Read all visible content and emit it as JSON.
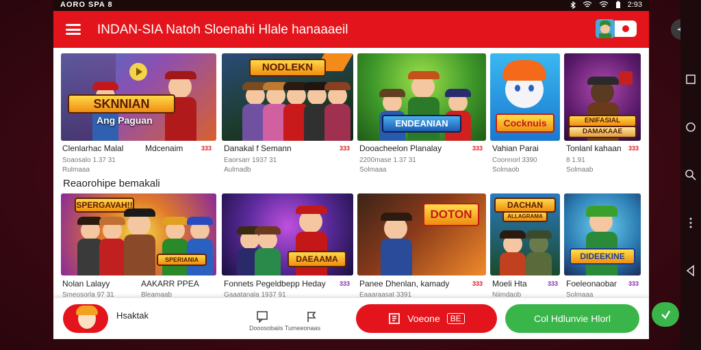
{
  "status_bar": {
    "left": "AORO SPA 8",
    "time": "2:93"
  },
  "header": {
    "title": "INDAN-SIA Natoh Sloenahi Hlale hanaaaeil"
  },
  "featured": [
    {
      "art": "SKNNIAN",
      "art2": "Ang Paguan",
      "title": "Clenlarhac Malal",
      "sub1": "Soaosalo 1.37 31",
      "sub2": "Rulmaaa",
      "extra": "Mdcenaim",
      "rating": "333"
    },
    {
      "art": "NODLEKN",
      "title": "Danakal f Semann",
      "sub1": "Eaorsarr 1937 31",
      "sub2": "Aulmadb",
      "rating": "333"
    },
    {
      "art": "ENDEANIAN",
      "title": "Dooacheelon Planalay",
      "sub1": "2200mase 1.37 31",
      "sub2": "Solmaaa",
      "rating": "333"
    },
    {
      "art": "Cocknuis",
      "title": "Vahian Parai",
      "sub1": "Coonnorl 3390",
      "sub2": "Solmaob",
      "rating": ""
    },
    {
      "art": "ENIFASIAL",
      "art2": "DAMAKAAE",
      "title": "Tonlanl kahaan",
      "sub1": "8 1.91",
      "sub2": "Solmaab",
      "rating": "333"
    }
  ],
  "section_title": "Reaorohipe bemakali",
  "recommended": [
    {
      "art": "SPERGAVAH!!",
      "art2": "SPERIANIA",
      "title": "Nolan Lalayy",
      "sub1": "Smeosorla 97 31",
      "sub2": "",
      "extra": "AAKARR PPEA",
      "extra_sub": "Bleamaab",
      "rating": ""
    },
    {
      "art": "DAEAAMA",
      "title": "Fonnets Pegeldbepp Heday",
      "sub1": "Gaaatanala 1937 91",
      "sub2": "",
      "rating": "333"
    },
    {
      "art": "DOTON",
      "title": "Panee Dhenlan, kamady",
      "sub1": "Eaaaraasat 3391",
      "sub2": "",
      "rating": "333"
    },
    {
      "art": "DACHAN",
      "art2": "ALLAGRAMA",
      "title": "Moeli Hta",
      "sub1": "Niimdaob",
      "sub2": "",
      "rating": "333"
    },
    {
      "art": "DIDEEKINE",
      "title": "Foeleonaobar",
      "sub1": "Solmaaa",
      "sub2": "",
      "rating": "333"
    }
  ],
  "bottom": {
    "label": "Hsaktak",
    "mid_label": "Dooosobaiis Tumeeonaas",
    "red_button": "Voeone",
    "red_button_badge": "BE",
    "green_button": "Col Hdlunvie Hlorl"
  },
  "colors": {
    "brand_red": "#e3141b",
    "green": "#3ab54a"
  },
  "icons": [
    "menu-icon",
    "wifi-icon",
    "battery-icon",
    "play-icon",
    "chat-icon",
    "flag-icon",
    "send-icon",
    "back-icon",
    "home-icon",
    "recent-apps-icon",
    "search-icon",
    "settings-icon",
    "more-icon"
  ]
}
